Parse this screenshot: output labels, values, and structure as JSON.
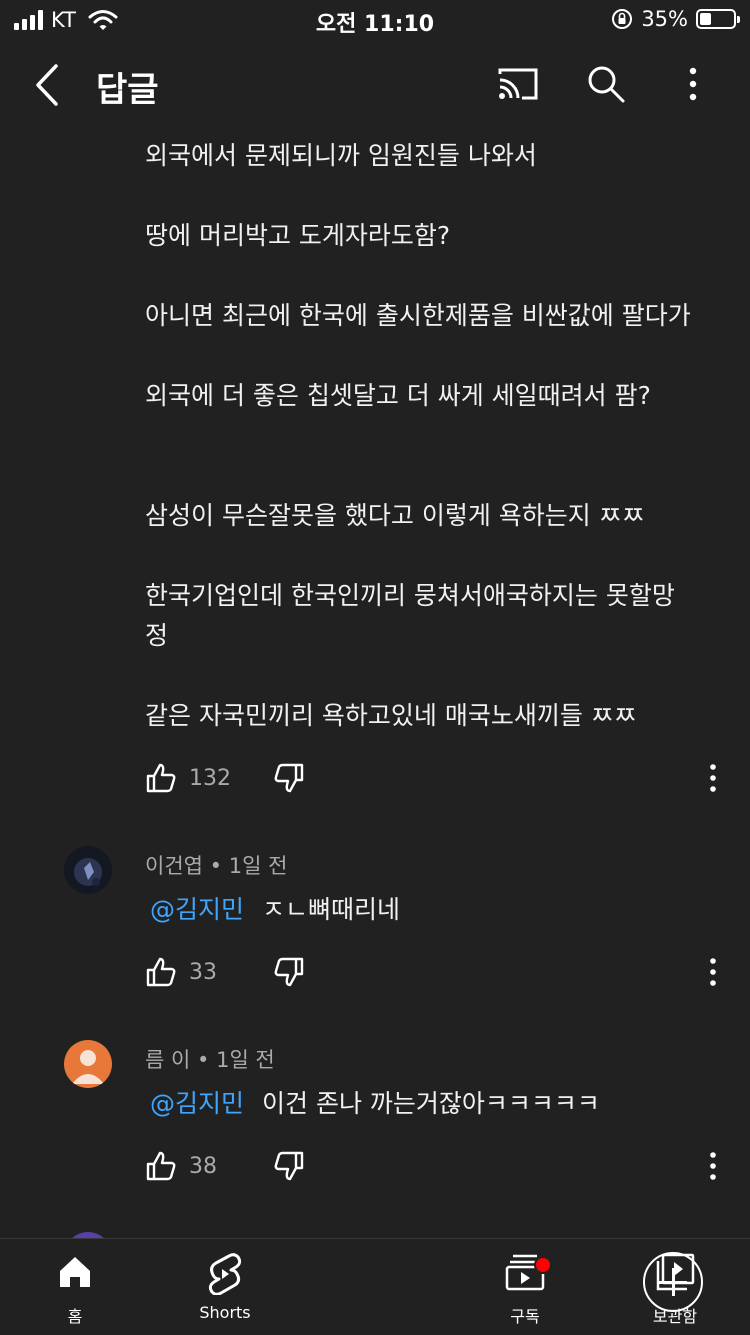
{
  "status_bar": {
    "carrier": "KT",
    "time": "오전 11:10",
    "battery": "35%",
    "battery_level": 0.35
  },
  "app_bar": {
    "title": "답글"
  },
  "comment": {
    "lines": [
      "외국에서 문제되니까 임원진들 나와서",
      "땅에 머리박고 도게자라도함?",
      "아니면 최근에 한국에 출시한제품을 비싼값에 팔다가",
      "외국에 더 좋은 칩셋달고 더 싸게 세일때려서 팜?",
      "삼성이 무슨잘못을 했다고 이렇게 욕하는지 ㅉㅉ",
      "한국기업인데 한국인끼리 뭉쳐서애국하지는 못할망",
      "정",
      "같은 자국민끼리 욕하고있네 매국노새끼들 ㅉㅉ"
    ],
    "likes": "132"
  },
  "replies": [
    {
      "author": "이건엽",
      "time": "1일 전",
      "mention": "@김지민",
      "text": "ㅈㄴ뼈때리네",
      "likes": "33"
    },
    {
      "author": "름 이",
      "time": "1일 전",
      "mention": "@김지민",
      "text": "이건 존나 까는거잖아ㅋㅋㅋㅋㅋ",
      "likes": "38"
    }
  ],
  "bottom_nav": [
    {
      "label": "홈",
      "icon": "home-icon"
    },
    {
      "label": "Shorts",
      "icon": "shorts-icon"
    },
    {
      "label": "",
      "icon": "create-icon"
    },
    {
      "label": "구독",
      "icon": "subscriptions-icon"
    },
    {
      "label": "보관함",
      "icon": "library-icon"
    }
  ],
  "colors": {
    "background": "#212121",
    "mention": "#3ea6ff",
    "secondary_text": "#aaaaaa",
    "notification_dot": "#ff0000"
  }
}
